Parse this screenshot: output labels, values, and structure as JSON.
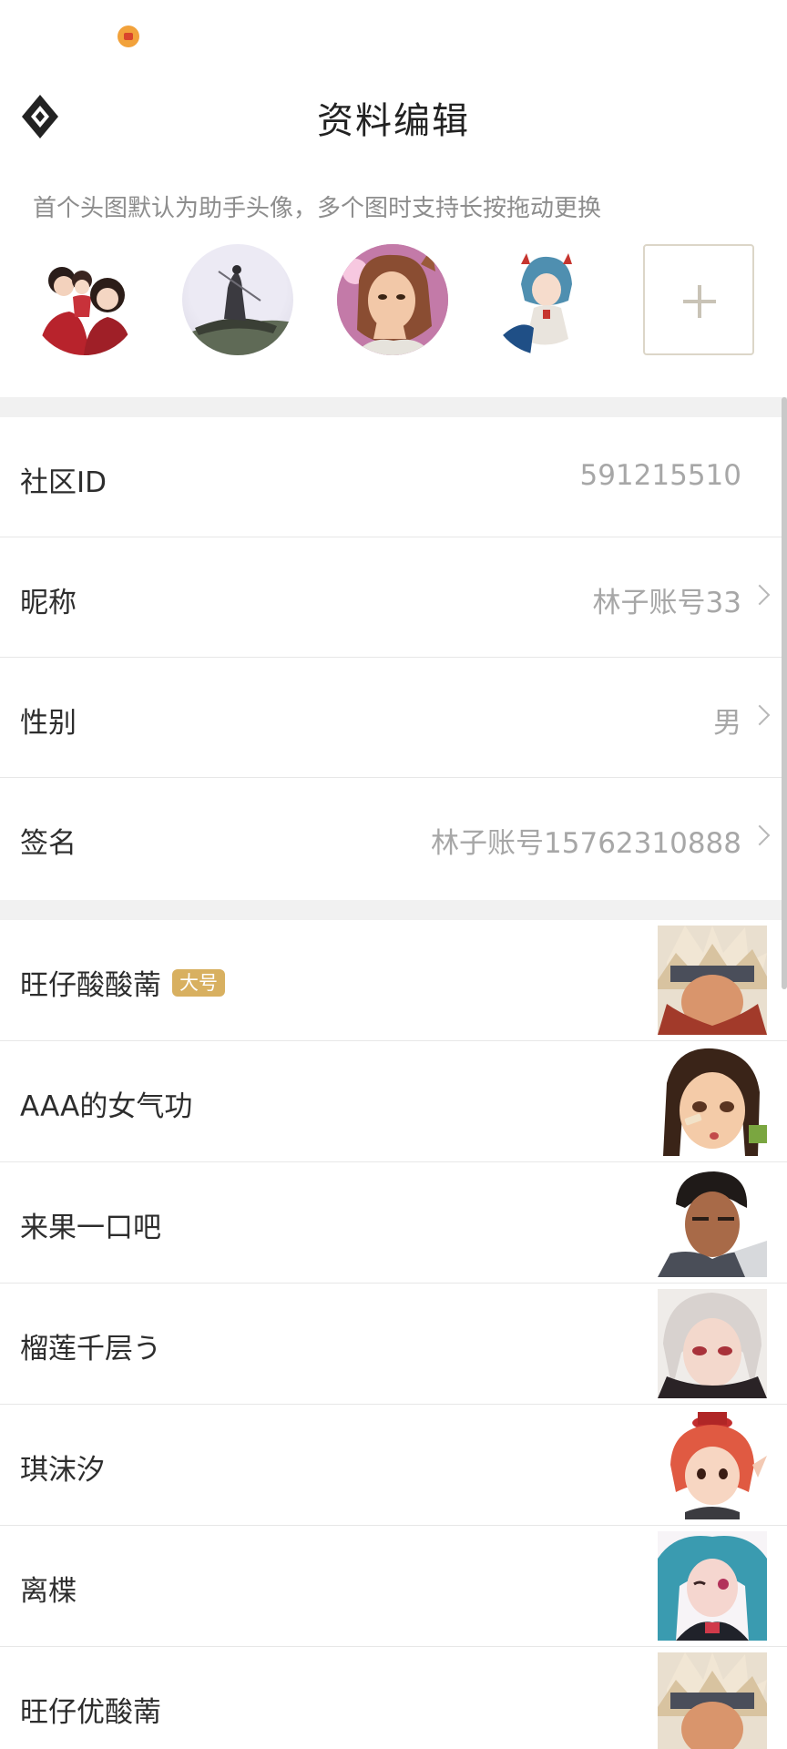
{
  "header": {
    "title": "资料编辑"
  },
  "avatars": {
    "hint": "首个头图默认为助手头像，多个图时支持长按拖动更换",
    "items": [
      "family-avatar",
      "swordsman-avatar",
      "girl-avatar",
      "blue-hair-avatar"
    ]
  },
  "profile": {
    "community_id": {
      "label": "社区ID",
      "value": "591215510"
    },
    "nickname": {
      "label": "昵称",
      "value": "林子账号33"
    },
    "gender": {
      "label": "性别",
      "value": "男"
    },
    "signature": {
      "label": "签名",
      "value": "林子账号15762310888"
    }
  },
  "roles": [
    {
      "name": "旺仔酸酸萳",
      "badge": "大号"
    },
    {
      "name": "AAA的女气功"
    },
    {
      "name": "来果一口吧"
    },
    {
      "name": "榴莲千层う"
    },
    {
      "name": "琪沫汐"
    },
    {
      "name": "离楪"
    },
    {
      "name": "旺仔优酸萳"
    }
  ],
  "colors": {
    "badge": "#d8b060",
    "value_text": "#a7a7a7",
    "divider": "#f1f1f1"
  }
}
